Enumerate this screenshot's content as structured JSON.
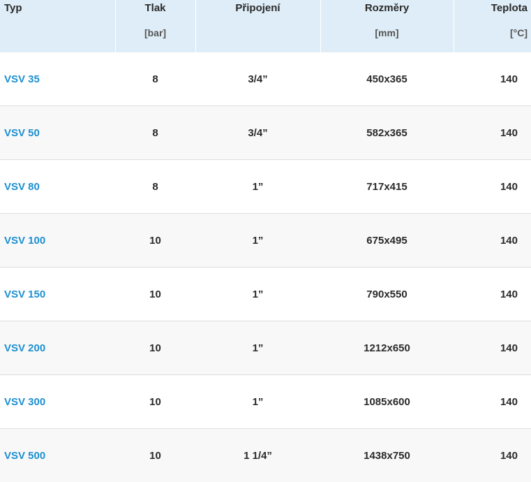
{
  "table": {
    "headers": [
      {
        "name": "Typ",
        "unit": ""
      },
      {
        "name": "Tlak",
        "unit": "[bar]"
      },
      {
        "name": "Připojení",
        "unit": ""
      },
      {
        "name": "Rozměry",
        "unit": "[mm]"
      },
      {
        "name": "Teplota",
        "unit": "[°C]"
      }
    ],
    "rows": [
      {
        "typ": "VSV 35",
        "tlak": "8",
        "pripojeni": "3/4”",
        "rozmery": "450x365",
        "teplota": "140"
      },
      {
        "typ": "VSV 50",
        "tlak": "8",
        "pripojeni": "3/4”",
        "rozmery": "582x365",
        "teplota": "140"
      },
      {
        "typ": "VSV 80",
        "tlak": "8",
        "pripojeni": "1”",
        "rozmery": "717x415",
        "teplota": "140"
      },
      {
        "typ": "VSV 100",
        "tlak": "10",
        "pripojeni": "1”",
        "rozmery": "675x495",
        "teplota": "140"
      },
      {
        "typ": "VSV 150",
        "tlak": "10",
        "pripojeni": "1”",
        "rozmery": "790x550",
        "teplota": "140"
      },
      {
        "typ": "VSV 200",
        "tlak": "10",
        "pripojeni": "1”",
        "rozmery": "1212x650",
        "teplota": "140"
      },
      {
        "typ": "VSV 300",
        "tlak": "10",
        "pripojeni": "1”",
        "rozmery": "1085x600",
        "teplota": "140"
      },
      {
        "typ": "VSV 500",
        "tlak": "10",
        "pripojeni": "1 1/4”",
        "rozmery": "1438x750",
        "teplota": "140"
      }
    ]
  },
  "colors": {
    "header_bg": "#deedf7",
    "link": "#1c8fd1",
    "row_alt": "#f8f8f8",
    "divider": "#dedede"
  }
}
